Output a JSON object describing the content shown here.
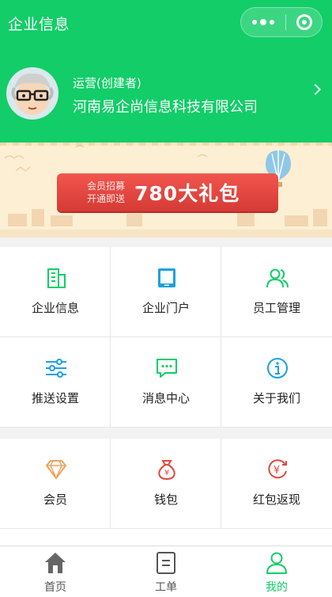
{
  "header": {
    "title": "企业信息",
    "role": "运营(创建者)",
    "company": "河南易企尚信息科技有限公司"
  },
  "banner": {
    "line1": "会员招募",
    "line2": "开通即送",
    "offer": "780大礼包"
  },
  "grid1": [
    {
      "label": "企业信息",
      "icon": "building-icon"
    },
    {
      "label": "企业门户",
      "icon": "tablet-icon"
    },
    {
      "label": "员工管理",
      "icon": "users-icon"
    },
    {
      "label": "推送设置",
      "icon": "sliders-icon"
    },
    {
      "label": "消息中心",
      "icon": "message-icon"
    },
    {
      "label": "关于我们",
      "icon": "info-icon"
    }
  ],
  "grid2": [
    {
      "label": "会员",
      "icon": "diamond-icon"
    },
    {
      "label": "钱包",
      "icon": "money-bag-icon"
    },
    {
      "label": "红包返现",
      "icon": "yen-refund-icon"
    }
  ],
  "tabs": [
    {
      "label": "首页",
      "icon": "home-icon"
    },
    {
      "label": "工单",
      "icon": "work-order-icon"
    },
    {
      "label": "我的",
      "icon": "person-icon"
    }
  ],
  "colors": {
    "brand": "#12cd68",
    "accent_icon": "#1aa1e0",
    "orange_icon": "#f0a35e",
    "red_icon": "#e2473d"
  }
}
